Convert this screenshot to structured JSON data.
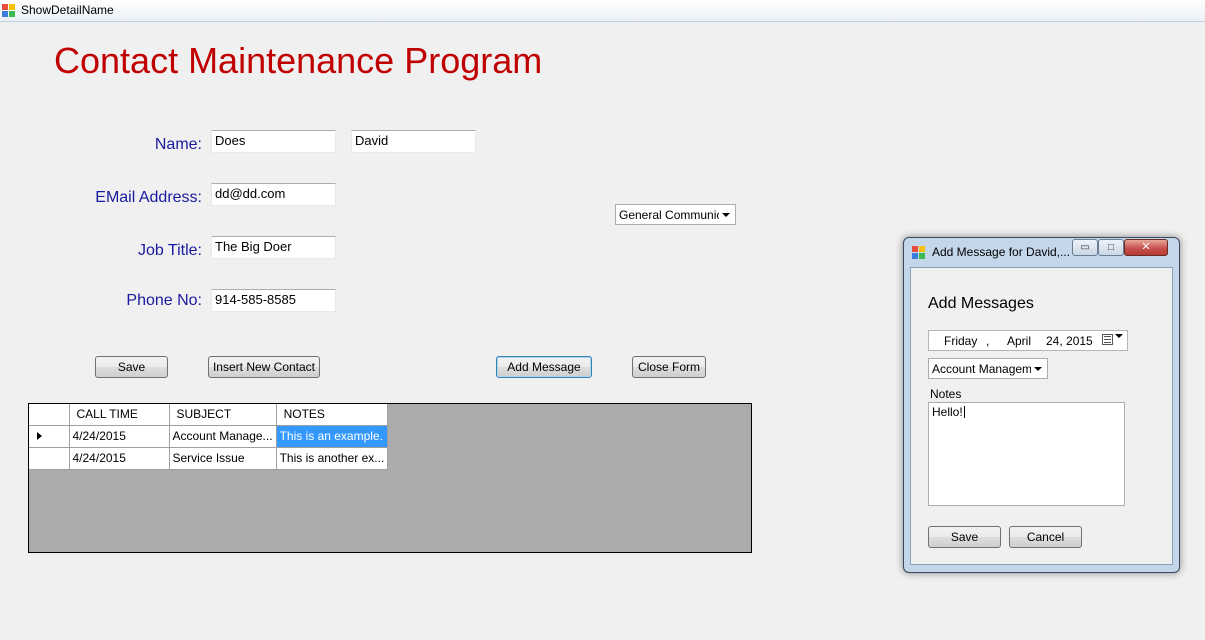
{
  "window": {
    "title": "ShowDetailName"
  },
  "page_title": "Contact Maintenance Program",
  "form": {
    "name_label": "Name:",
    "last_name": "Does",
    "first_name": "David",
    "email_label": "EMail Address:",
    "email": "dd@dd.com",
    "job_label": "Job Title:",
    "job_title": "The Big Doer",
    "phone_label": "Phone No:",
    "phone": "914-585-8585",
    "category_select": "General Communicat"
  },
  "buttons": {
    "save": "Save",
    "insert": "Insert New Contact",
    "add_message": "Add Message",
    "close_form": "Close Form"
  },
  "grid": {
    "columns": [
      "CALL TIME",
      "SUBJECT",
      "NOTES"
    ],
    "rows": [
      {
        "call_time": "4/24/2015",
        "subject": "Account Manage...",
        "notes": "This is an example."
      },
      {
        "call_time": "4/24/2015",
        "subject": "Service Issue",
        "notes": "This is another ex..."
      }
    ]
  },
  "dialog": {
    "title": "Add Message for David,...",
    "heading": "Add Messages",
    "date": {
      "weekday": "Friday",
      "sep": ",",
      "month": "April",
      "day_year": "24, 2015"
    },
    "subject_select": "Account Managemer",
    "notes_label": "Notes",
    "notes_value": "Hello!",
    "save": "Save",
    "cancel": "Cancel",
    "minimize_glyph": "▭",
    "maximize_glyph": "□",
    "close_glyph": "✕"
  },
  "colors": {
    "title_red": "#c00000",
    "label_blue": "#1a1aa0",
    "selection_blue": "#3399ff"
  }
}
